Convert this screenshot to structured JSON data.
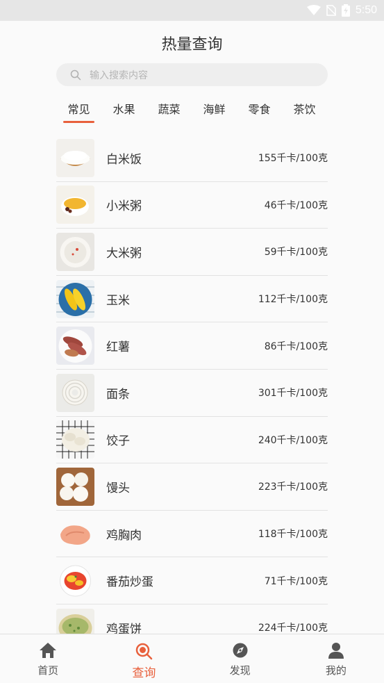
{
  "status_bar": {
    "time": "5:50"
  },
  "header": {
    "title": "热量查询"
  },
  "search": {
    "placeholder": "输入搜索内容"
  },
  "category_tabs": [
    {
      "label": "常见",
      "active": true
    },
    {
      "label": "水果",
      "active": false
    },
    {
      "label": "蔬菜",
      "active": false
    },
    {
      "label": "海鲜",
      "active": false
    },
    {
      "label": "零食",
      "active": false
    },
    {
      "label": "茶饮",
      "active": false
    }
  ],
  "foods": [
    {
      "name": "白米饭",
      "calories": "155千卡/100克"
    },
    {
      "name": "小米粥",
      "calories": "46千卡/100克"
    },
    {
      "name": "大米粥",
      "calories": "59千卡/100克"
    },
    {
      "name": "玉米",
      "calories": "112千卡/100克"
    },
    {
      "name": "红薯",
      "calories": "86千卡/100克"
    },
    {
      "name": "面条",
      "calories": "301千卡/100克"
    },
    {
      "name": "饺子",
      "calories": "240千卡/100克"
    },
    {
      "name": "馒头",
      "calories": "223千卡/100克"
    },
    {
      "name": "鸡胸肉",
      "calories": "118千卡/100克"
    },
    {
      "name": "番茄炒蛋",
      "calories": "71千卡/100克"
    },
    {
      "name": "鸡蛋饼",
      "calories": "224千卡/100克"
    }
  ],
  "bottom_nav": [
    {
      "label": "首页",
      "icon": "home-icon",
      "active": false
    },
    {
      "label": "查询",
      "icon": "search-icon",
      "active": true
    },
    {
      "label": "发现",
      "icon": "discover-icon",
      "active": false
    },
    {
      "label": "我的",
      "icon": "profile-icon",
      "active": false
    }
  ],
  "colors": {
    "accent": "#e8603c",
    "icon_gray": "#555555"
  }
}
